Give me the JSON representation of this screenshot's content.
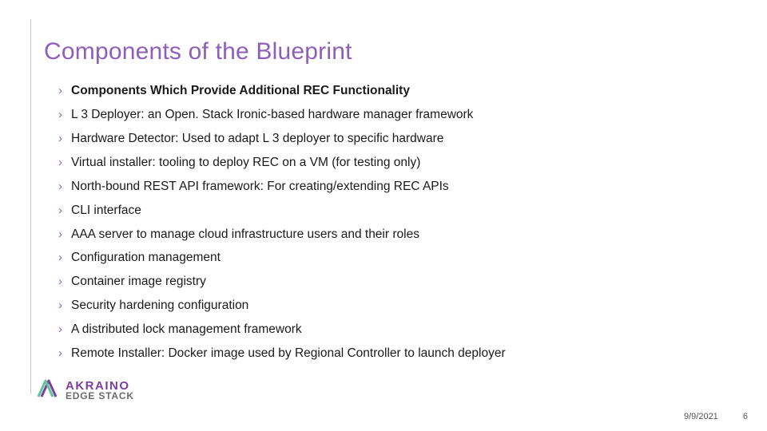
{
  "slide": {
    "title": "Components of the Blueprint",
    "bullets": [
      {
        "text": "Components Which Provide Additional REC Functionality",
        "bold": true
      },
      {
        "text": "L 3 Deployer: an Open. Stack Ironic-based hardware manager framework",
        "bold": false
      },
      {
        "text": "Hardware Detector: Used to adapt L 3 deployer to specific hardware",
        "bold": false
      },
      {
        "text": "Virtual installer: tooling to deploy REC on a VM (for testing only)",
        "bold": false
      },
      {
        "text": "North-bound REST API framework: For creating/extending REC APIs",
        "bold": false
      },
      {
        "text": "CLI interface",
        "bold": false
      },
      {
        "text": "AAA server to manage cloud infrastructure users and their roles",
        "bold": false
      },
      {
        "text": "Configuration management",
        "bold": false
      },
      {
        "text": "Container image registry",
        "bold": false
      },
      {
        "text": "Security hardening configuration",
        "bold": false
      },
      {
        "text": "A distributed lock management framework",
        "bold": false
      },
      {
        "text": "Remote Installer: Docker image used by Regional Controller to launch deployer",
        "bold": false
      }
    ]
  },
  "logo": {
    "line1": "AKRAINO",
    "line2": "EDGE STACK"
  },
  "footer": {
    "date": "9/9/2021",
    "page": "6"
  }
}
